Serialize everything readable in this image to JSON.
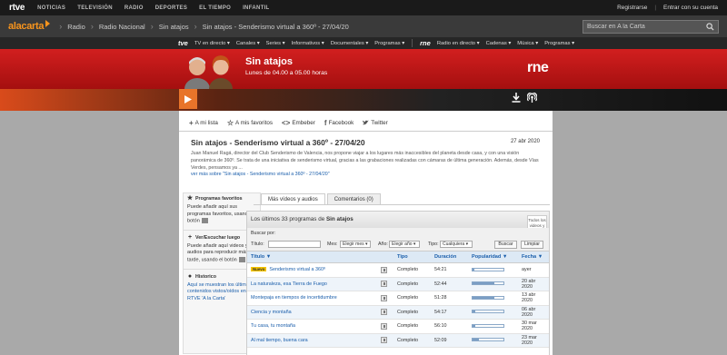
{
  "topbar": {
    "logo": "rtve",
    "nav": [
      "NOTICIAS",
      "TELEVISIÓN",
      "RADIO",
      "DEPORTES",
      "EL TIEMPO",
      "INFANTIL"
    ],
    "register": "Registrarse",
    "login": "Entrar con su cuenta"
  },
  "alacarta": {
    "logo": "alacarta",
    "breadcrumb": [
      "Radio",
      "Radio Nacional",
      "Sin atajos",
      "Sin atajos - Senderismo virtual a 360º - 27/04/20"
    ],
    "search_placeholder": "Buscar en A la Carta"
  },
  "channels": {
    "tve_logo": "tve",
    "tve_items": [
      "TV en directo ▾",
      "Canales ▾",
      "Series ▾",
      "Informativos ▾",
      "Documentales ▾",
      "Programas ▾"
    ],
    "rne_logo": "rne",
    "rne_items": [
      "Radio en directo ▾",
      "Cadenas ▾",
      "Música ▾",
      "Programas ▾"
    ]
  },
  "program": {
    "title": "Sin atajos",
    "schedule": "Lunes de 04.00 a 05.00 horas",
    "network_logo": "rne"
  },
  "share": {
    "list": "A mi lista",
    "favorites": "A mis favoritos",
    "embed": "Embeber",
    "facebook": "Facebook",
    "twitter": "Twitter"
  },
  "episode": {
    "title": "Sin atajos - Senderismo virtual a 360º - 27/04/20",
    "date": "27 abr 2020",
    "description": "Juan Manuel Ragá, director del Club Senderismo de Valencia, nos propone viajar a los lugares más inaccesibles del planeta desde casa, y con una visión panorámica de 360º. Se trata de una iniciativa de senderismo virtual, gracias a las grabaciones realizadas con cámaras de última generación. Además, desde Vías Verdes, pensamos ya ...",
    "more_link": "ver más sobre \"Sin atajos - Senderismo virtual a 360º - 27/04/20\""
  },
  "sidebar": {
    "fav_title": "Programas favoritos",
    "fav_text": "Puede añadir aquí sus programas favoritos, usando el botón",
    "later_title": "Ver/Escuchar luego",
    "later_text": "Puede añadir aquí videos y audios para reproducir más tarde, usando el botón",
    "history_title": "Historico",
    "history_text": "Aquí se muestran los últimos contenidos vistos/oídos en RTVE 'A la Carta'"
  },
  "tabs": [
    "Más vídeos y audios",
    "Comentarios (0)"
  ],
  "listbox": {
    "header_prefix": "Los últimos 33 programas de ",
    "header_program": "Sin atajos",
    "all_tag": "Todos los videos y audios",
    "search_by": "Buscar por:",
    "title_label": "Título:",
    "month_label": "Mes:",
    "month_value": "Elegir mes",
    "year_label": "Año:",
    "year_value": "Elegir año",
    "type_label": "Tipo:",
    "type_value": "Cualquiera",
    "search_btn": "Buscar",
    "clear_btn": "Limpiar",
    "columns": [
      "Título ▼",
      "Tipo",
      "Duración",
      "Popularidad ▼",
      "Fecha ▼"
    ],
    "new_badge": "Nuevo",
    "rows": [
      {
        "title": "Senderismo virtual a 360º",
        "type": "Completo",
        "duration": "54:21",
        "popularity": 0.05,
        "date": "ayer",
        "is_new": true
      },
      {
        "title": "La naturaleza, esa Tierra de Fuego",
        "type": "Completo",
        "duration": "52:44",
        "popularity": 0.72,
        "date": "20 abr 2020",
        "is_new": false
      },
      {
        "title": "Montepaja en tiempos de incertidumbre",
        "type": "Completo",
        "duration": "51:28",
        "popularity": 0.72,
        "date": "13 abr 2020",
        "is_new": false
      },
      {
        "title": "Ciencia y montaña",
        "type": "Completo",
        "duration": "54:17",
        "popularity": 0.1,
        "date": "06 abr 2020",
        "is_new": false
      },
      {
        "title": "Tu casa, tu montaña",
        "type": "Completo",
        "duration": "56:10",
        "popularity": 0.1,
        "date": "30 mar 2020",
        "is_new": false
      },
      {
        "title": "Al mal tiempo, buena cara",
        "type": "Completo",
        "duration": "52:09",
        "popularity": 0.2,
        "date": "23 mar 2020",
        "is_new": false
      }
    ]
  }
}
